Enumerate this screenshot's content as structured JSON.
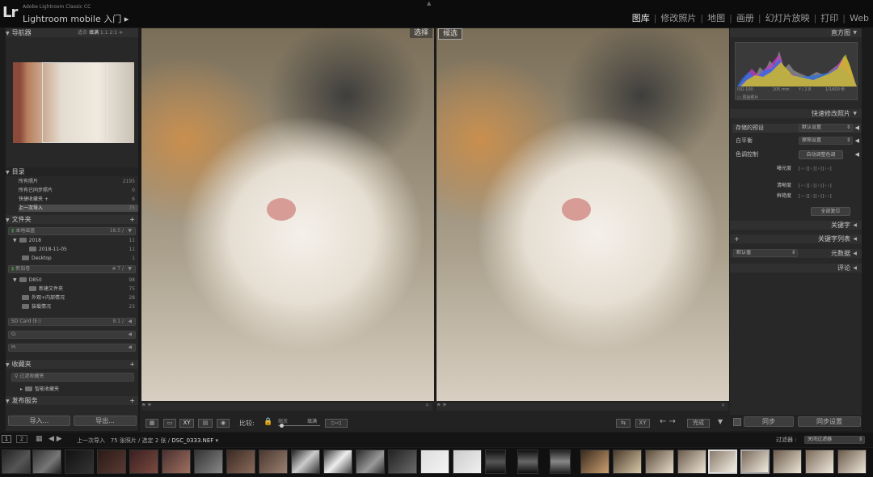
{
  "app": {
    "logo": "Lr",
    "subtitle": "Adobe Lightroom Classic CC",
    "name": "Lightroom mobile 入门"
  },
  "modules": [
    "图库",
    "修改照片",
    "地图",
    "画册",
    "幻灯片放映",
    "打印",
    "Web"
  ],
  "active_module": "图库",
  "navigator": {
    "title": "导航器",
    "zoom": [
      "适合",
      "填满",
      "1:1",
      "2:1"
    ]
  },
  "catalog": {
    "title": "目录",
    "items": [
      {
        "label": "所有照片",
        "count": "2195"
      },
      {
        "label": "所有已同步照片",
        "count": "0"
      },
      {
        "label": "快捷收藏夹  +",
        "count": "6"
      },
      {
        "label": "上一次导入",
        "count": "75"
      }
    ]
  },
  "folders": {
    "title": "文件夹",
    "groups": [
      {
        "label": "本地磁盘",
        "right": "18.5 /",
        "items": [
          {
            "label": "2018",
            "count": "11",
            "indent": 0
          },
          {
            "label": "2018-11-05",
            "count": "11",
            "indent": 1
          },
          {
            "label": "Desktop",
            "count": "1",
            "indent": 0
          }
        ]
      },
      {
        "label": "新加卷",
        "right": "# T /",
        "items": [
          {
            "label": "D850",
            "count": "98",
            "indent": 0
          },
          {
            "label": "新建文件夹",
            "count": "75",
            "indent": 1
          },
          {
            "label": "外观+内部情况",
            "count": "28",
            "indent": 0
          },
          {
            "label": "装载情况",
            "count": "23",
            "indent": 0
          }
        ]
      },
      {
        "label": "SD Card (E:)",
        "right": "8.1 /",
        "items": []
      },
      {
        "label": "G:",
        "right": "",
        "items": []
      },
      {
        "label": "H:",
        "right": "",
        "items": []
      }
    ]
  },
  "collections": {
    "title": "收藏夹",
    "filter": "过滤收藏夹",
    "smart": "智能收藏夹"
  },
  "publish": {
    "title": "发布服务"
  },
  "left_buttons": {
    "import": "导入...",
    "export": "导出..."
  },
  "views": {
    "select": "选择",
    "candidate": "候选"
  },
  "toolbar": {
    "compare": "比较:",
    "zoom": "缩放",
    "fill": "填满",
    "done": "完成"
  },
  "filmstrip": {
    "pages": [
      "1",
      "2"
    ],
    "path": "上一次导入",
    "info": "75 张照片 / 选定 2 张 /",
    "filename": "DSC_0333.NEF",
    "filter_label": "过滤器 :",
    "filter_value": "关闭过滤器"
  },
  "histogram": {
    "title": "直方图",
    "iso": "ISO 100",
    "focal": "105 mm",
    "aperture": "f / 2.8",
    "shutter": "1/1600 秒",
    "original": "原始照片"
  },
  "quick_develop": {
    "title": "快速修改照片",
    "saved_preset": "存储的预设",
    "saved_preset_value": "默认设置",
    "white_balance": "白平衡",
    "white_balance_value": "原照设置",
    "tone_control": "色调控制",
    "auto_tone": "自动调整色调",
    "exposure": "曝光度",
    "clarity": "清晰度",
    "vibrance": "鲜艳度",
    "reset": "全部复位"
  },
  "keywords": {
    "title": "关键字"
  },
  "keyword_list": {
    "title": "关键字列表"
  },
  "metadata": {
    "title": "元数据",
    "preset": "默认值"
  },
  "comments": {
    "title": "评论"
  },
  "right_buttons": {
    "sync": "同步",
    "sync_settings": "同步设置"
  }
}
